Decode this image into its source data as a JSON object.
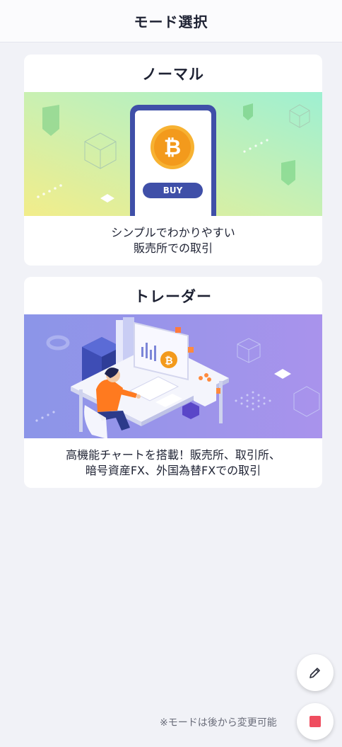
{
  "header": {
    "title": "モード選択"
  },
  "modes": [
    {
      "title": "ノーマル",
      "description_lines": [
        "シンプルでわかりやすい",
        "販売所での取引"
      ],
      "button_label": "BUY"
    },
    {
      "title": "トレーダー",
      "description_lines": [
        "高機能チャートを搭載！販売所、取引所、",
        "暗号資産FX、外国為替FXでの取引"
      ]
    }
  ],
  "footer": {
    "note": "※モードは後から変更可能"
  },
  "icons": {
    "edit": "pencil-icon",
    "record": "stop-square-icon",
    "coin": "bitcoin-icon"
  },
  "colors": {
    "accent": "#3f4fa8",
    "bitcoin": "#f39a1c",
    "record": "#ef4d5f"
  }
}
